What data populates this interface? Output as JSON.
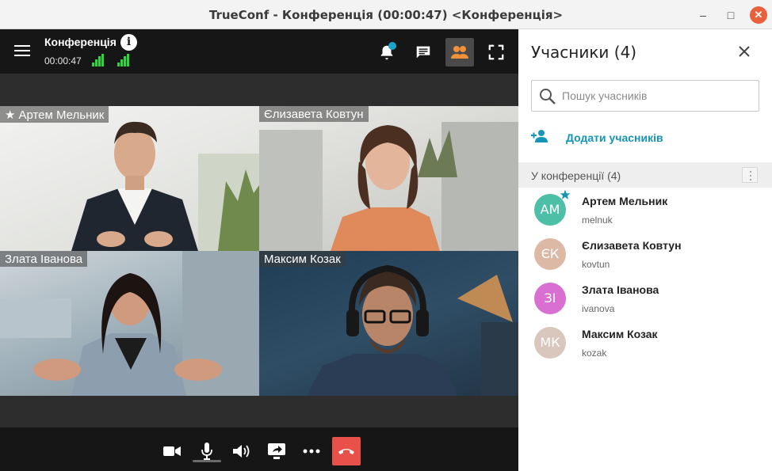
{
  "window": {
    "title": "TrueConf - Конференція (00:00:47) <Конференція>",
    "minimize_glyph": "–",
    "maximize_glyph": "□",
    "close_glyph": "✕"
  },
  "conference": {
    "title": "Конференція",
    "info_glyph": "i",
    "time": "00:00:47"
  },
  "toolbar_icons": [
    "bell-icon",
    "chat-icon",
    "participants-icon",
    "fullscreen-icon"
  ],
  "video_tiles": [
    {
      "name": "Артем Мельник",
      "is_owner": true
    },
    {
      "name": "Єлизавета Ковтун"
    },
    {
      "name": "Злата Іванова"
    },
    {
      "name": "Максим Козак"
    }
  ],
  "bottom_controls": [
    "camera-icon",
    "microphone-icon",
    "speaker-icon",
    "share-screen-icon",
    "more-icon",
    "hang-up-icon"
  ],
  "panel": {
    "title": "Учасники (4)",
    "search_placeholder": "Пошук учасників",
    "add_label": "Додати учасників",
    "section_label": "У конференції (4)",
    "participants": [
      {
        "initials": "АМ",
        "name": "Артем Мельник",
        "login": "melnuk",
        "color": "#4dbfa6",
        "owner": true
      },
      {
        "initials": "ЄК",
        "name": "Єлизавета Ковтун",
        "login": "kovtun",
        "color": "#dbb9a4"
      },
      {
        "initials": "ЗІ",
        "name": "Злата Іванова",
        "login": "ivanova",
        "color": "#d96fd1"
      },
      {
        "initials": "МК",
        "name": "Максим Козак",
        "login": "kozak",
        "color": "#d9c7bd"
      }
    ]
  },
  "colors": {
    "accent": "#1596b8",
    "hang_up": "#e8504a",
    "signal": "#2ed53a",
    "notification_dot": "#1aa4c8"
  }
}
